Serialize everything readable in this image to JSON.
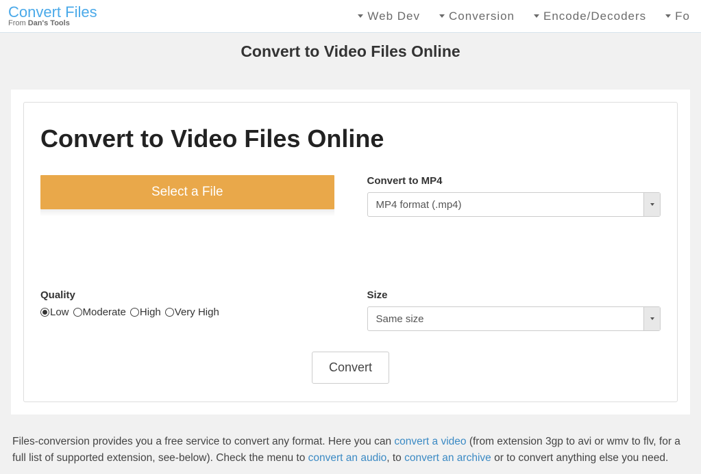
{
  "brand": {
    "title": "Convert Files",
    "sub_prefix": "From ",
    "sub_bold": "Dan's Tools"
  },
  "nav": {
    "items": [
      {
        "label": "Web Dev"
      },
      {
        "label": "Conversion"
      },
      {
        "label": "Encode/Decoders"
      },
      {
        "label": "Fo"
      }
    ]
  },
  "page": {
    "title": "Convert to Video Files Online"
  },
  "panel": {
    "title": "Convert to Video Files Online"
  },
  "upload": {
    "button_label": "Select a File"
  },
  "format": {
    "label": "Convert to MP4",
    "selected": "MP4 format (.mp4)"
  },
  "quality": {
    "label": "Quality",
    "options": [
      {
        "label": "Low",
        "checked": true
      },
      {
        "label": "Moderate",
        "checked": false
      },
      {
        "label": "High",
        "checked": false
      },
      {
        "label": "Very High",
        "checked": false
      }
    ]
  },
  "size": {
    "label": "Size",
    "selected": "Same size"
  },
  "actions": {
    "convert": "Convert"
  },
  "description": {
    "p1a": "Files-conversion provides you a free service to convert any format. Here you can ",
    "link1": "convert a video",
    "p1b": " (from extension 3gp to avi or wmv to flv, for a full list of supported extension, see-below). Check the menu to ",
    "link2": "convert an audio",
    "p1c": ", to ",
    "link3": "convert an archive",
    "p1d": " or to convert anything else you need."
  }
}
